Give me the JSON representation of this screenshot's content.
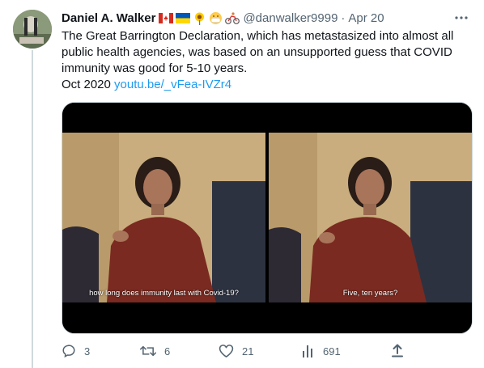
{
  "tweet": {
    "author_name": "Daniel A. Walker",
    "author_emojis": [
      "canada-flag-icon",
      "ukraine-flag-icon",
      "sunflower-icon",
      "mask-face-icon",
      "cyclist-icon"
    ],
    "handle": "@danwalker9999",
    "separator": "·",
    "date": "Apr 20",
    "text": "The Great Barrington Declaration, which has metastasized into almost all public health agencies, was based on an unsupported guess that COVID immunity was good for 5-10 years.",
    "note_prefix": "Oct 2020",
    "link_text": "youtu.be/_vFea-IVZr4"
  },
  "media": {
    "frames": [
      {
        "subtitle": "how long does immunity last with Covid-19?"
      },
      {
        "subtitle": "Five, ten years?"
      }
    ]
  },
  "actions": {
    "reply_count": "3",
    "retweet_count": "6",
    "like_count": "21",
    "views_count": "691"
  },
  "colors": {
    "link": "#1d9bf0",
    "secondary_text": "#536471",
    "text": "#0f1419"
  }
}
